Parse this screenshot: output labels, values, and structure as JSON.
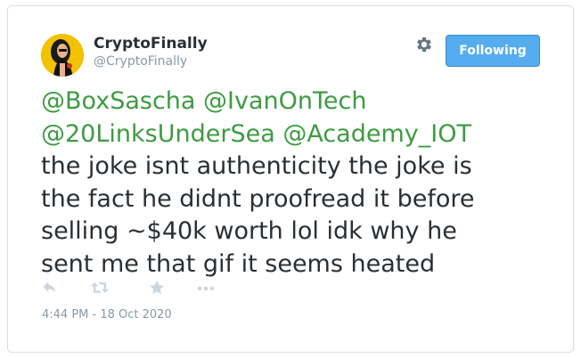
{
  "author": {
    "display_name": "CryptoFinally",
    "handle": "@CryptoFinally"
  },
  "follow_button": {
    "label": "Following"
  },
  "tweet": {
    "mentions_line1": [
      "@BoxSascha",
      "@IvanOnTech"
    ],
    "mentions_line2": [
      "@20LinksUnderSea",
      "@Academy_IOT"
    ],
    "body_lines": [
      "the joke isnt authenticity the joke is",
      "the fact he didnt proofread it before",
      "selling ~$40k worth lol idk why he",
      "sent me that gif it seems heated"
    ]
  },
  "timestamp": "4:44 PM - 18 Oct 2020",
  "icons": {
    "settings": "gear-icon",
    "reply": "reply-icon",
    "retweet": "retweet-icon",
    "like": "star-icon",
    "more": "more-icon"
  },
  "colors": {
    "mention": "#3d9b42",
    "text": "#292f33",
    "muted": "#8899a6",
    "button_bg": "#55acee",
    "button_border": "#3b88c3",
    "avatar_bg": "#f2c200"
  }
}
